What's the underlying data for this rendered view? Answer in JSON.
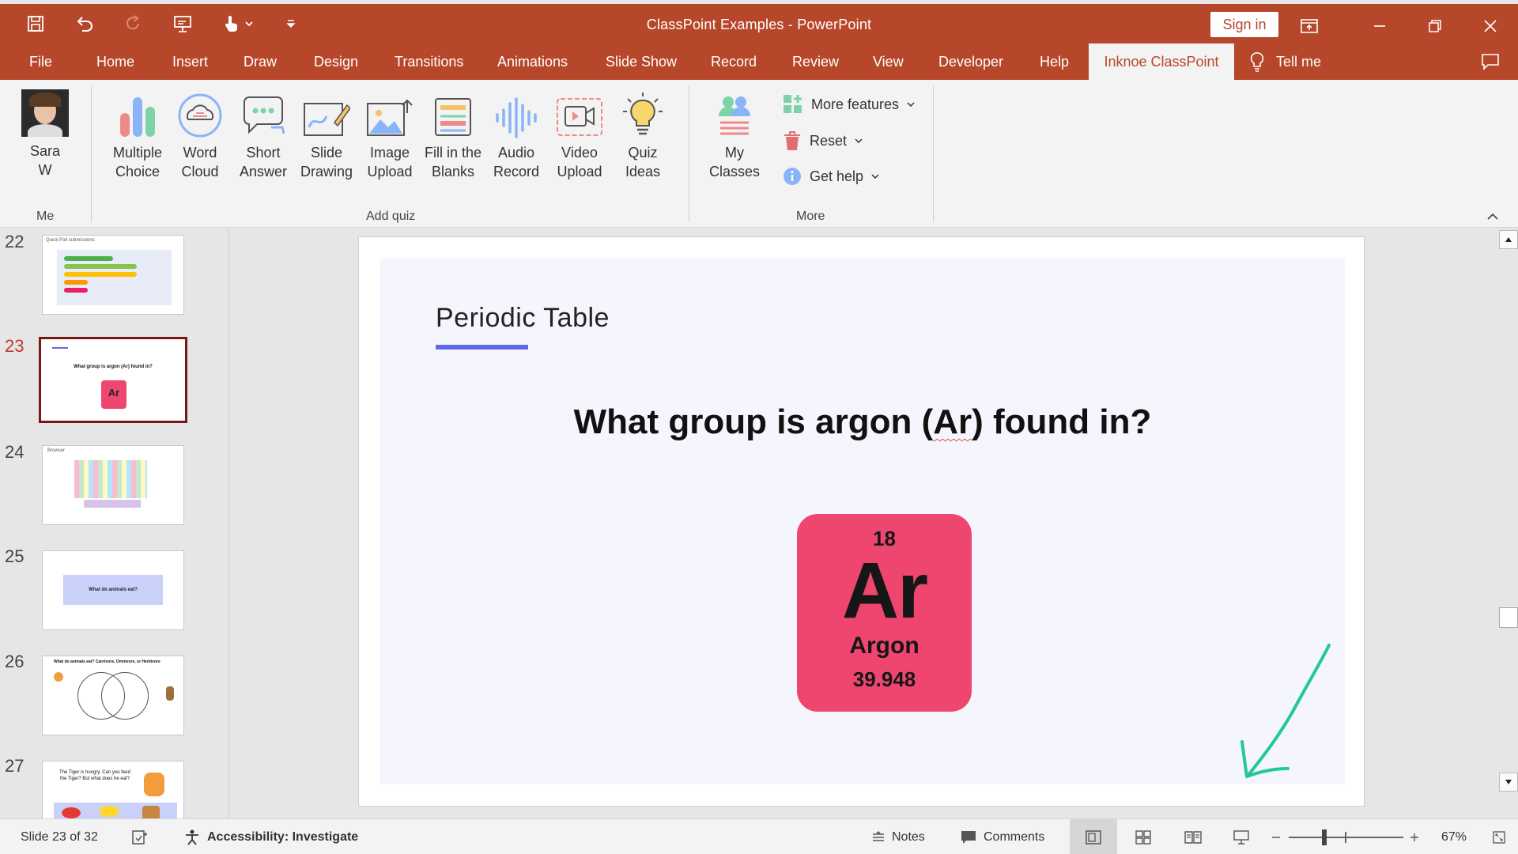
{
  "window": {
    "title": "ClassPoint Examples  -  PowerPoint",
    "sign_in": "Sign in"
  },
  "quick_access": {
    "icons": [
      "save-icon",
      "undo-icon",
      "redo-icon",
      "present-icon",
      "touch-mode-icon",
      "customize-icon"
    ]
  },
  "menu": {
    "tabs": [
      "File",
      "Home",
      "Insert",
      "Draw",
      "Design",
      "Transitions",
      "Animations",
      "Slide Show",
      "Record",
      "Review",
      "View",
      "Developer",
      "Help",
      "Inknoe ClassPoint"
    ],
    "active_tab": "Inknoe ClassPoint",
    "tell_me": "Tell me"
  },
  "ribbon": {
    "me": {
      "name": "Sara W",
      "group_label": "Me"
    },
    "add_quiz": {
      "group_label": "Add quiz",
      "buttons": [
        "Multiple Choice",
        "Word Cloud",
        "Short Answer",
        "Slide Drawing",
        "Image Upload",
        "Fill in the Blanks",
        "Audio Record",
        "Video Upload",
        "Quiz Ideas"
      ]
    },
    "more": {
      "group_label": "More",
      "my_classes": "My Classes",
      "more_features": "More features",
      "reset": "Reset",
      "get_help": "Get help"
    }
  },
  "thumbnails": [
    {
      "number": "22",
      "caption": "Quick Poll submissions"
    },
    {
      "number": "23",
      "caption": "What group is argon (Ar) found in?",
      "selected": true
    },
    {
      "number": "24",
      "caption": "Browser"
    },
    {
      "number": "25",
      "caption": "What do animals eat?"
    },
    {
      "number": "26",
      "caption": "What do animals eat? Carnivore, Omnivore, or Herbivore"
    },
    {
      "number": "27",
      "caption": "The Tiger is hungry. Can you feed the Tiger? But what does he eat?"
    }
  ],
  "slide": {
    "title": "Periodic Table",
    "question_before": "What group is argon (",
    "question_marked": "Ar",
    "question_after": ") found in?",
    "element": {
      "number": "18",
      "symbol": "Ar",
      "name": "Argon",
      "mass": "39.948"
    },
    "arrow_color": "#20c997"
  },
  "status": {
    "slide_position": "Slide 23 of 32",
    "accessibility": "Accessibility: Investigate",
    "notes": "Notes",
    "comments": "Comments",
    "zoom": "67%"
  },
  "colors": {
    "accent": "#b7472a",
    "element_tile": "#ef4670",
    "title_underline": "#6069e8"
  }
}
